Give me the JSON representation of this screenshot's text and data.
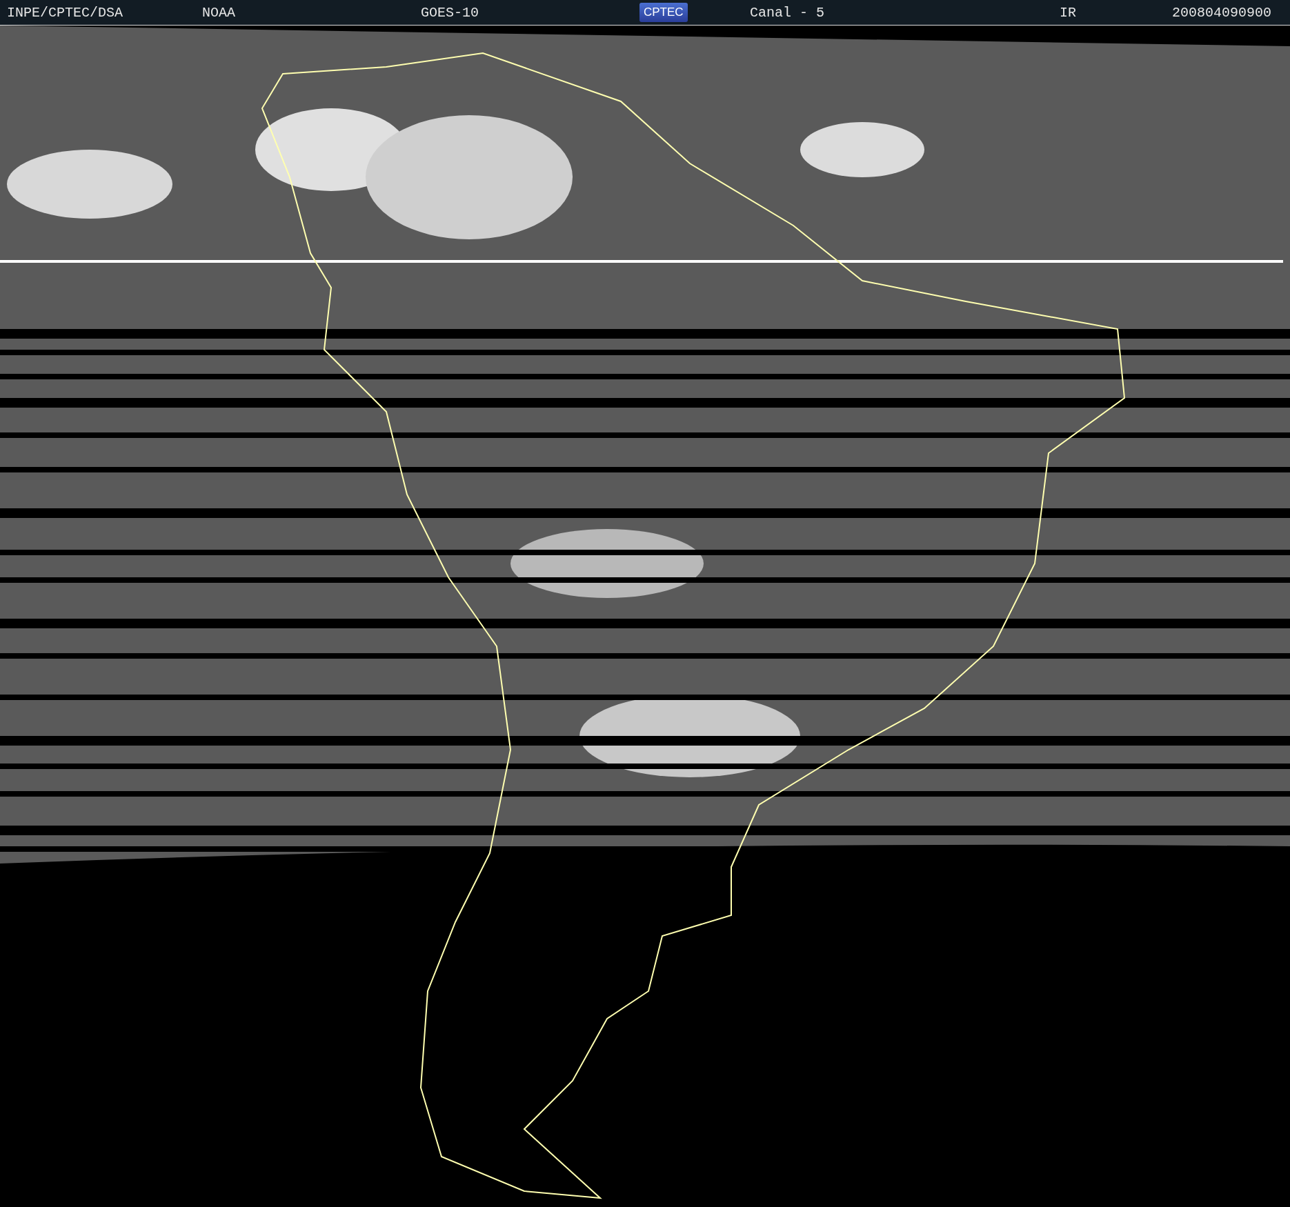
{
  "header": {
    "items": [
      {
        "kind": "text",
        "text": "INPE/CPTEC/DSA"
      },
      {
        "kind": "text",
        "text": "NOAA"
      },
      {
        "kind": "text",
        "text": "GOES-10"
      },
      {
        "kind": "logo",
        "text": "CPTEC"
      },
      {
        "kind": "text",
        "text": "Canal - 5"
      },
      {
        "kind": "text",
        "text": "IR"
      },
      {
        "kind": "text",
        "text": "200804090900"
      }
    ]
  }
}
